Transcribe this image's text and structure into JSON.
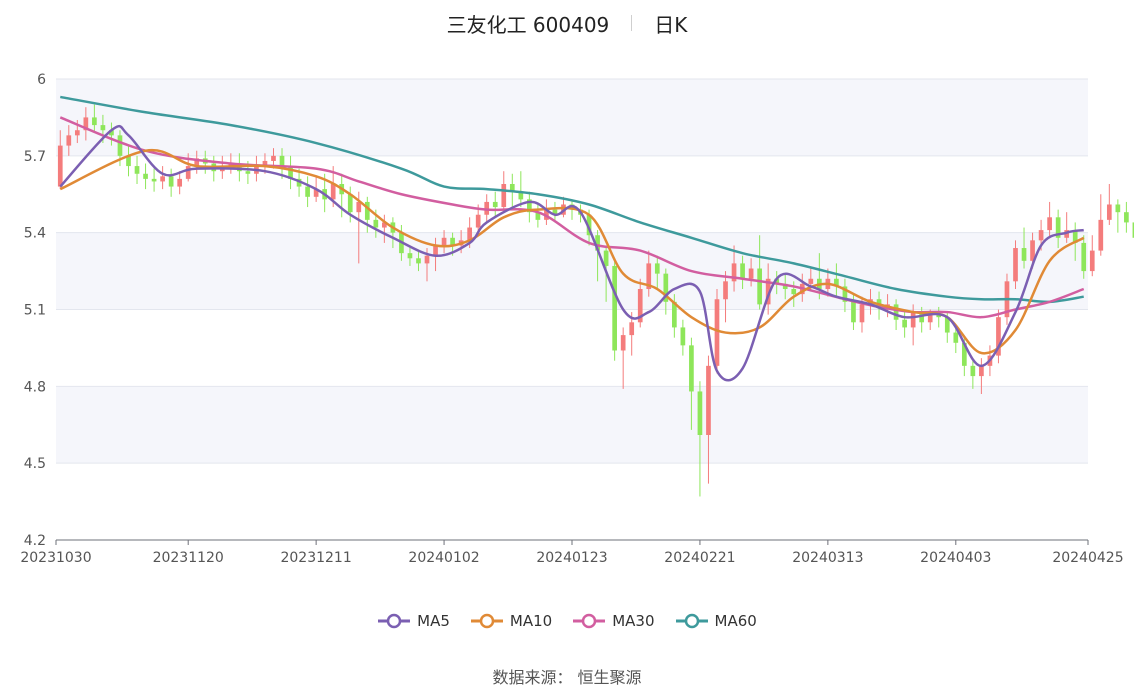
{
  "title": {
    "name": "三友化工 600409",
    "period": "日K"
  },
  "source": {
    "label": "数据来源：",
    "value": "恒生聚源"
  },
  "colors": {
    "up": "#f47c7c",
    "down": "#8ee65a",
    "grid": "#e3e6ee",
    "band": "#f5f6fb"
  },
  "chart_data": {
    "type": "candlestick",
    "ylim": [
      4.2,
      6.0
    ],
    "y_ticks": [
      "6",
      "5.7",
      "5.4",
      "5.1",
      "4.8",
      "4.5",
      "4.2"
    ],
    "y_tick_values": [
      6.0,
      5.7,
      5.4,
      5.1,
      4.8,
      4.5,
      4.2
    ],
    "x_ticks": [
      "20231030",
      "20231120",
      "20231211",
      "20240102",
      "20240123",
      "20240221",
      "20240313",
      "20240403",
      "20240425"
    ],
    "x_tick_index": [
      0,
      15,
      30,
      45,
      60,
      75,
      90,
      105,
      120
    ],
    "num_days": 121,
    "grid": true,
    "legend_position": "bottom",
    "candles": [
      [
        5.58,
        5.74,
        5.8,
        5.57
      ],
      [
        5.74,
        5.78,
        5.82,
        5.7
      ],
      [
        5.78,
        5.8,
        5.84,
        5.75
      ],
      [
        5.8,
        5.85,
        5.89,
        5.76
      ],
      [
        5.85,
        5.82,
        5.9,
        5.79
      ],
      [
        5.82,
        5.8,
        5.86,
        5.75
      ],
      [
        5.8,
        5.78,
        5.83,
        5.74
      ],
      [
        5.78,
        5.7,
        5.8,
        5.66
      ],
      [
        5.7,
        5.66,
        5.74,
        5.62
      ],
      [
        5.66,
        5.63,
        5.7,
        5.59
      ],
      [
        5.63,
        5.61,
        5.67,
        5.57
      ],
      [
        5.61,
        5.6,
        5.65,
        5.56
      ],
      [
        5.6,
        5.62,
        5.66,
        5.57
      ],
      [
        5.62,
        5.58,
        5.65,
        5.54
      ],
      [
        5.58,
        5.61,
        5.64,
        5.55
      ],
      [
        5.61,
        5.66,
        5.71,
        5.6
      ],
      [
        5.66,
        5.69,
        5.72,
        5.63
      ],
      [
        5.69,
        5.67,
        5.72,
        5.63
      ],
      [
        5.67,
        5.64,
        5.7,
        5.6
      ],
      [
        5.64,
        5.66,
        5.7,
        5.61
      ],
      [
        5.66,
        5.67,
        5.71,
        5.63
      ],
      [
        5.67,
        5.64,
        5.71,
        5.6
      ],
      [
        5.64,
        5.63,
        5.68,
        5.59
      ],
      [
        5.63,
        5.66,
        5.7,
        5.6
      ],
      [
        5.66,
        5.68,
        5.71,
        5.63
      ],
      [
        5.68,
        5.7,
        5.73,
        5.65
      ],
      [
        5.7,
        5.66,
        5.73,
        5.61
      ],
      [
        5.66,
        5.61,
        5.7,
        5.57
      ],
      [
        5.61,
        5.58,
        5.65,
        5.54
      ],
      [
        5.58,
        5.54,
        5.62,
        5.5
      ],
      [
        5.54,
        5.57,
        5.62,
        5.52
      ],
      [
        5.57,
        5.53,
        5.63,
        5.48
      ],
      [
        5.53,
        5.59,
        5.66,
        5.5
      ],
      [
        5.59,
        5.55,
        5.63,
        5.46
      ],
      [
        5.55,
        5.48,
        5.58,
        5.44
      ],
      [
        5.48,
        5.52,
        5.56,
        5.28
      ],
      [
        5.52,
        5.45,
        5.54,
        5.4
      ],
      [
        5.45,
        5.42,
        5.49,
        5.38
      ],
      [
        5.42,
        5.44,
        5.47,
        5.36
      ],
      [
        5.44,
        5.4,
        5.46,
        5.34
      ],
      [
        5.4,
        5.32,
        5.43,
        5.29
      ],
      [
        5.32,
        5.3,
        5.35,
        5.27
      ],
      [
        5.3,
        5.28,
        5.33,
        5.25
      ],
      [
        5.28,
        5.31,
        5.34,
        5.21
      ],
      [
        5.31,
        5.35,
        5.38,
        5.25
      ],
      [
        5.35,
        5.38,
        5.41,
        5.32
      ],
      [
        5.38,
        5.35,
        5.4,
        5.31
      ],
      [
        5.35,
        5.37,
        5.41,
        5.32
      ],
      [
        5.37,
        5.42,
        5.46,
        5.34
      ],
      [
        5.42,
        5.47,
        5.51,
        5.4
      ],
      [
        5.47,
        5.52,
        5.55,
        5.44
      ],
      [
        5.52,
        5.5,
        5.56,
        5.46
      ],
      [
        5.5,
        5.59,
        5.64,
        5.48
      ],
      [
        5.59,
        5.56,
        5.63,
        5.5
      ],
      [
        5.56,
        5.53,
        5.64,
        5.5
      ],
      [
        5.53,
        5.48,
        5.56,
        5.44
      ],
      [
        5.48,
        5.45,
        5.51,
        5.42
      ],
      [
        5.45,
        5.49,
        5.53,
        5.43
      ],
      [
        5.49,
        5.47,
        5.52,
        5.44
      ],
      [
        5.47,
        5.51,
        5.54,
        5.46
      ],
      [
        5.51,
        5.49,
        5.53,
        5.45
      ],
      [
        5.49,
        5.47,
        5.51,
        5.44
      ],
      [
        5.47,
        5.39,
        5.49,
        5.35
      ],
      [
        5.39,
        5.33,
        5.41,
        5.21
      ],
      [
        5.33,
        5.27,
        5.35,
        5.13
      ],
      [
        5.27,
        4.94,
        5.3,
        4.9
      ],
      [
        4.94,
        5.0,
        5.03,
        4.79
      ],
      [
        5.0,
        5.05,
        5.09,
        4.92
      ],
      [
        5.05,
        5.18,
        5.22,
        5.03
      ],
      [
        5.18,
        5.28,
        5.33,
        5.15
      ],
      [
        5.28,
        5.24,
        5.31,
        5.18
      ],
      [
        5.24,
        5.13,
        5.26,
        5.08
      ],
      [
        5.13,
        5.03,
        5.16,
        4.99
      ],
      [
        5.03,
        4.96,
        5.06,
        4.92
      ],
      [
        4.96,
        4.78,
        4.99,
        4.63
      ],
      [
        4.78,
        4.61,
        4.82,
        4.37
      ],
      [
        4.61,
        4.88,
        4.92,
        4.42
      ],
      [
        4.88,
        5.14,
        5.18,
        4.85
      ],
      [
        5.14,
        5.21,
        5.25,
        5.05
      ],
      [
        5.21,
        5.28,
        5.35,
        5.17
      ],
      [
        5.28,
        5.22,
        5.31,
        5.18
      ],
      [
        5.22,
        5.26,
        5.3,
        5.19
      ],
      [
        5.26,
        5.12,
        5.39,
        5.1
      ],
      [
        5.12,
        5.22,
        5.28,
        5.08
      ],
      [
        5.22,
        5.2,
        5.25,
        5.16
      ],
      [
        5.2,
        5.18,
        5.24,
        5.14
      ],
      [
        5.18,
        5.16,
        5.21,
        5.11
      ],
      [
        5.16,
        5.2,
        5.24,
        5.13
      ],
      [
        5.2,
        5.22,
        5.26,
        5.17
      ],
      [
        5.22,
        5.18,
        5.32,
        5.14
      ],
      [
        5.18,
        5.22,
        5.26,
        5.15
      ],
      [
        5.22,
        5.19,
        5.28,
        5.15
      ],
      [
        5.19,
        5.13,
        5.22,
        5.09
      ],
      [
        5.13,
        5.05,
        5.16,
        5.02
      ],
      [
        5.05,
        5.12,
        5.15,
        5.01
      ],
      [
        5.12,
        5.14,
        5.18,
        5.08
      ],
      [
        5.14,
        5.11,
        5.17,
        5.06
      ],
      [
        5.11,
        5.12,
        5.16,
        5.07
      ],
      [
        5.12,
        5.06,
        5.14,
        5.02
      ],
      [
        5.06,
        5.03,
        5.09,
        4.99
      ],
      [
        5.03,
        5.09,
        5.12,
        4.96
      ],
      [
        5.09,
        5.05,
        5.11,
        5.01
      ],
      [
        5.05,
        5.08,
        5.1,
        5.02
      ],
      [
        5.08,
        5.07,
        5.11,
        5.03
      ],
      [
        5.07,
        5.01,
        5.09,
        4.97
      ],
      [
        5.01,
        4.97,
        5.03,
        4.93
      ],
      [
        4.97,
        4.88,
        4.99,
        4.84
      ],
      [
        4.88,
        4.84,
        4.9,
        4.79
      ],
      [
        4.84,
        4.88,
        4.91,
        4.77
      ],
      [
        4.88,
        4.92,
        4.96,
        4.84
      ],
      [
        4.92,
        5.07,
        5.1,
        4.89
      ],
      [
        5.07,
        5.21,
        5.24,
        5.04
      ],
      [
        5.21,
        5.34,
        5.37,
        5.18
      ],
      [
        5.34,
        5.29,
        5.42,
        5.26
      ],
      [
        5.29,
        5.37,
        5.4,
        5.26
      ],
      [
        5.37,
        5.41,
        5.45,
        5.33
      ],
      [
        5.41,
        5.46,
        5.52,
        5.38
      ],
      [
        5.46,
        5.38,
        5.49,
        5.34
      ],
      [
        5.38,
        5.41,
        5.48,
        5.36
      ],
      [
        5.41,
        5.36,
        5.44,
        5.29
      ],
      [
        5.36,
        5.25,
        5.39,
        5.22
      ],
      [
        5.25,
        5.33,
        5.39,
        5.23
      ],
      [
        5.33,
        5.45,
        5.55,
        5.31
      ],
      [
        5.45,
        5.51,
        5.59,
        5.43
      ],
      [
        5.51,
        5.48,
        5.53,
        5.4
      ],
      [
        5.48,
        5.44,
        5.52,
        5.4
      ],
      [
        5.44,
        5.38,
        5.49,
        5.3
      ],
      [
        5.38,
        5.35,
        5.41,
        5.29
      ],
      [
        5.35,
        5.38,
        5.42,
        5.33
      ],
      [
        5.38,
        5.48,
        5.53,
        5.35
      ],
      [
        5.48,
        5.37,
        5.49,
        5.34
      ]
    ],
    "series": [
      {
        "name": "MA5",
        "color": "#7b5fb2",
        "x": [
          0,
          6,
          8,
          12,
          16,
          24,
          30,
          34,
          39,
          44,
          48,
          50,
          55,
          58,
          61,
          66,
          69,
          72,
          75,
          77,
          80,
          84,
          88,
          91,
          95,
          99,
          104,
          108,
          112,
          115,
          118,
          120
        ],
        "values": [
          5.58,
          5.8,
          5.78,
          5.63,
          5.65,
          5.64,
          5.57,
          5.47,
          5.38,
          5.31,
          5.36,
          5.44,
          5.52,
          5.47,
          5.48,
          5.1,
          5.09,
          5.18,
          5.17,
          4.86,
          4.87,
          5.22,
          5.19,
          5.15,
          5.12,
          5.07,
          5.07,
          4.88,
          5.09,
          5.35,
          5.4,
          5.41
        ]
      },
      {
        "name": "MA10",
        "color": "#e08a36",
        "x": [
          0,
          10,
          16,
          24,
          30,
          34,
          39,
          44,
          48,
          52,
          56,
          62,
          66,
          70,
          74,
          78,
          82,
          86,
          90,
          95,
          100,
          104,
          108,
          112,
          116,
          120
        ],
        "values": [
          5.57,
          5.72,
          5.66,
          5.66,
          5.62,
          5.55,
          5.42,
          5.35,
          5.37,
          5.46,
          5.49,
          5.47,
          5.24,
          5.18,
          5.07,
          5.01,
          5.03,
          5.15,
          5.2,
          5.13,
          5.09,
          5.07,
          4.93,
          5.02,
          5.29,
          5.38
        ]
      },
      {
        "name": "MA30",
        "color": "#d25ea0",
        "x": [
          0,
          10,
          20,
          30,
          35,
          40,
          46,
          50,
          56,
          62,
          68,
          74,
          80,
          86,
          92,
          96,
          100,
          104,
          108,
          112,
          116,
          120
        ],
        "values": [
          5.85,
          5.72,
          5.67,
          5.65,
          5.6,
          5.55,
          5.51,
          5.49,
          5.48,
          5.36,
          5.33,
          5.25,
          5.22,
          5.19,
          5.14,
          5.11,
          5.09,
          5.09,
          5.07,
          5.1,
          5.13,
          5.18
        ]
      },
      {
        "name": "MA60",
        "color": "#3e9a9c",
        "x": [
          0,
          10,
          20,
          30,
          40,
          45,
          50,
          56,
          62,
          68,
          74,
          80,
          86,
          92,
          98,
          104,
          108,
          112,
          116,
          120
        ],
        "values": [
          5.93,
          5.87,
          5.82,
          5.75,
          5.65,
          5.58,
          5.57,
          5.55,
          5.51,
          5.44,
          5.38,
          5.32,
          5.28,
          5.23,
          5.18,
          5.15,
          5.14,
          5.14,
          5.13,
          5.15
        ]
      }
    ]
  }
}
